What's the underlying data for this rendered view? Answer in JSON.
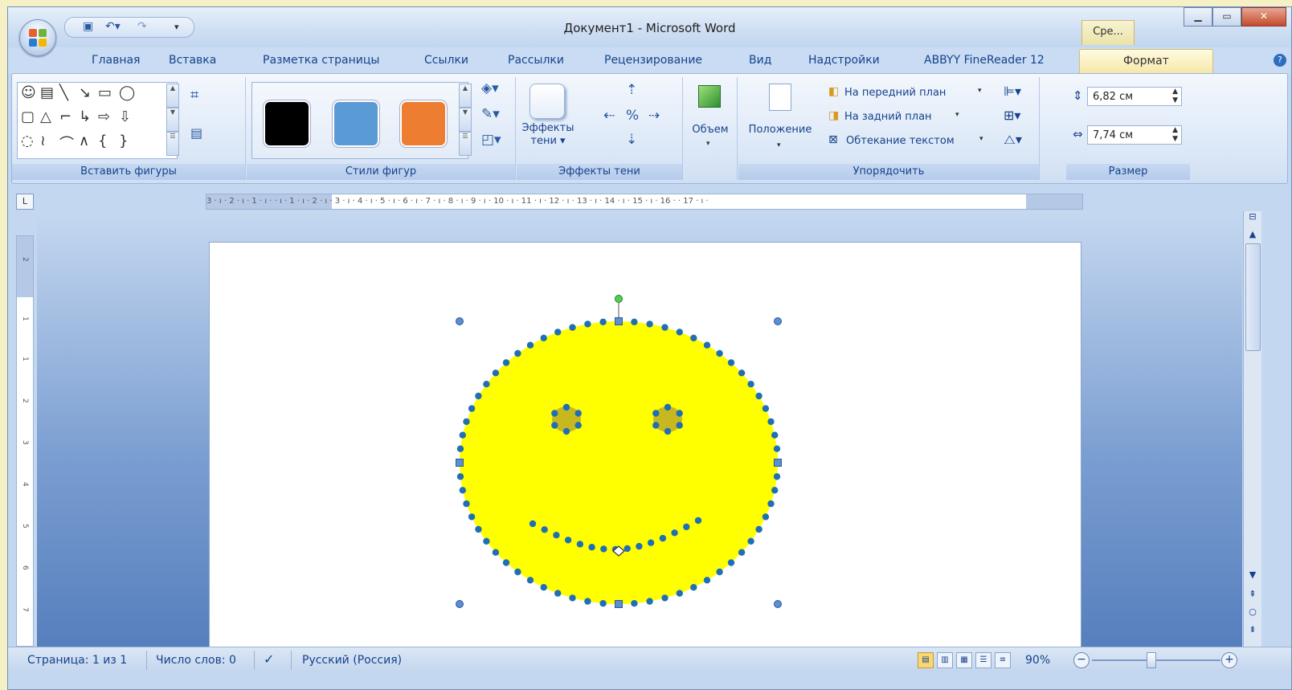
{
  "window": {
    "title": "Документ1 - Microsoft Word",
    "context_tab_top": "Сре...",
    "buttons": [
      "minimize-icon",
      "maximize-icon",
      "close-icon"
    ]
  },
  "quick_access": [
    "save-icon",
    "undo-icon",
    "redo-icon",
    "customize-icon"
  ],
  "tabs": [
    {
      "label": "Главная"
    },
    {
      "label": "Вставка"
    },
    {
      "label": "Разметка страницы"
    },
    {
      "label": "Ссылки"
    },
    {
      "label": "Рассылки"
    },
    {
      "label": "Рецензирование"
    },
    {
      "label": "Вид"
    },
    {
      "label": "Надстройки"
    },
    {
      "label": "ABBYY FineReader 12"
    },
    {
      "label": "Формат",
      "active": true
    }
  ],
  "ribbon": {
    "insert_shapes": {
      "label": "Вставить фигуры"
    },
    "shape_styles": {
      "label": "Стили фигур",
      "swatches": [
        "#000000",
        "#5b9bd5",
        "#ed7d31"
      ]
    },
    "shadow_effects": {
      "label": "Эффекты тени",
      "button_line1": "Эффекты",
      "button_line2": "тени ▾"
    },
    "volume": {
      "label": "Объем"
    },
    "arrange": {
      "label": "Упорядочить",
      "position": "Положение",
      "bring_front": "На передний план",
      "send_back": "На задний план",
      "wrap_text": "Обтекание текстом"
    },
    "size": {
      "label": "Размер",
      "height": "6,82 см",
      "width": "7,74 см"
    }
  },
  "ruler": {
    "text": "3 · ı · 2 · ı · 1 · ı ·   · ı · 1 · ı · 2 · ı · 3 · ı · 4 · ı · 5 · ı · 6 · ı · 7 · ı · 8 · ı · 9 · ı · 10 · ı · 11 · ı · 12 · ı · 13 · ı · 14 · ı · 15 · ı · 16 ·   · 17 · ı ·",
    "vertical_marks": [
      "2",
      "1",
      "1",
      "2",
      "3",
      "4",
      "5",
      "6",
      "7"
    ]
  },
  "shape": {
    "fill": "#ffff00",
    "point_color": "#1f6fb5"
  },
  "status": {
    "page": "Страница: 1 из 1",
    "words": "Число слов: 0",
    "language": "Русский (Россия)",
    "zoom": "90%"
  }
}
